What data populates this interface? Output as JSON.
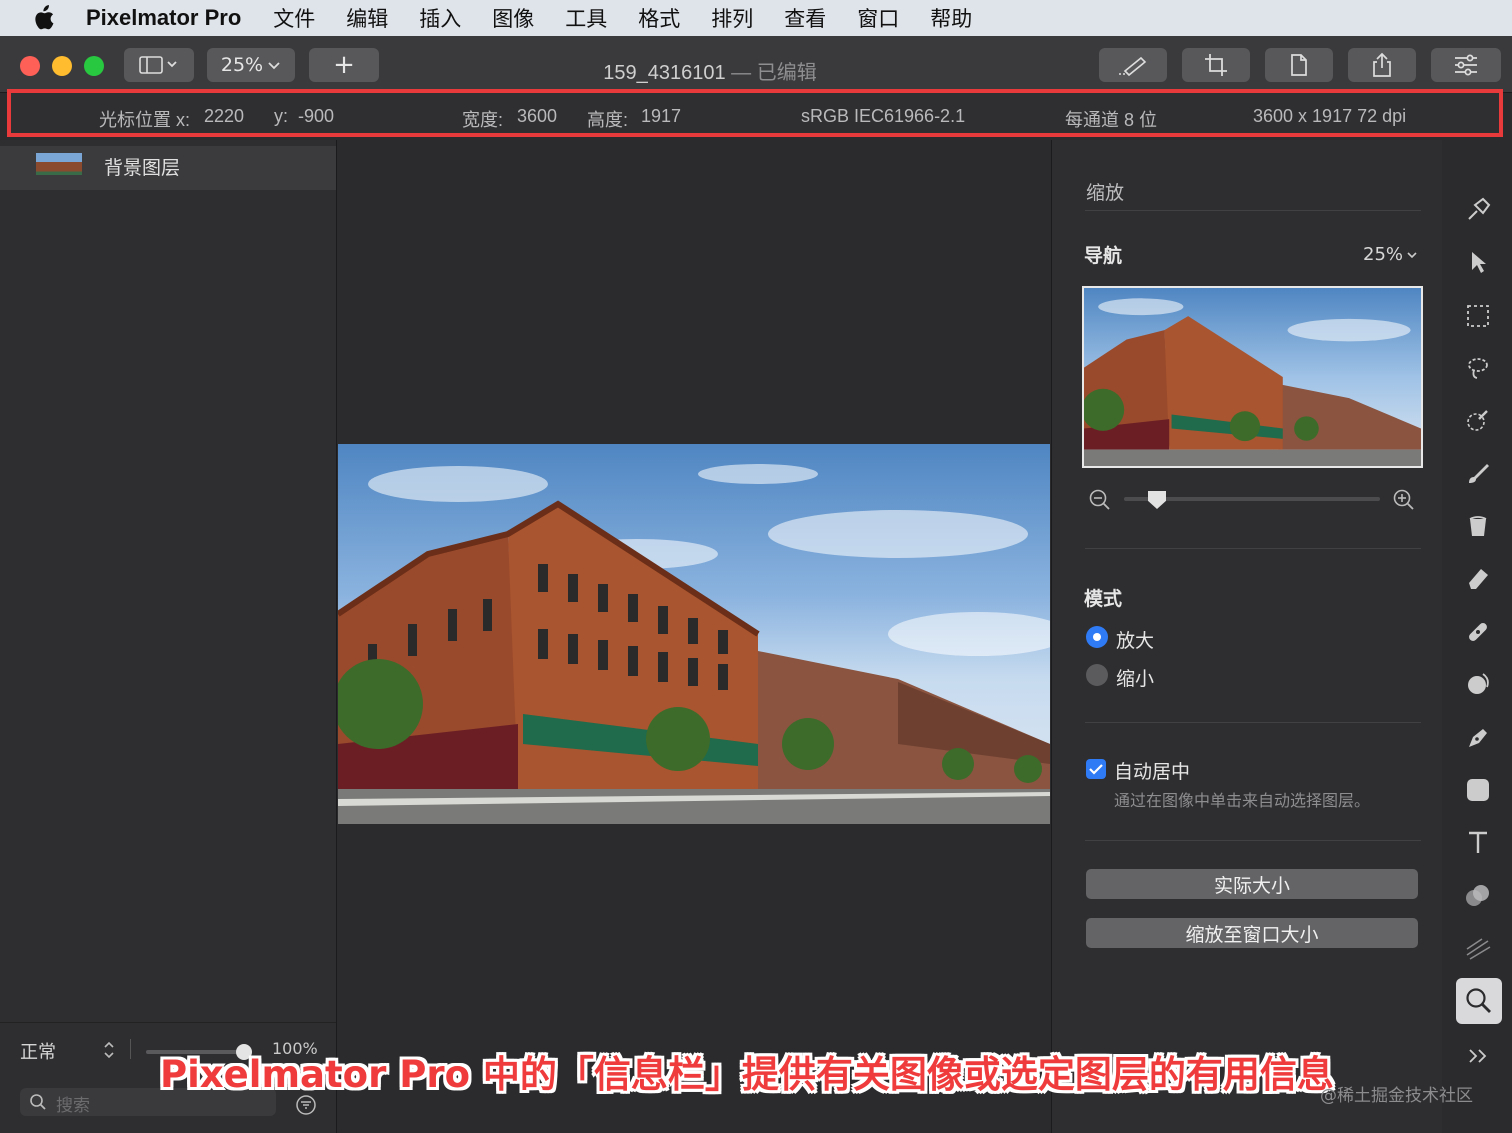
{
  "menubar": {
    "app_name": "Pixelmator Pro",
    "items": [
      "文件",
      "编辑",
      "插入",
      "图像",
      "工具",
      "格式",
      "排列",
      "查看",
      "窗口",
      "帮助"
    ]
  },
  "toolbar": {
    "zoom_label": "25%",
    "add_label": "+",
    "doc_name": "159_4316101",
    "doc_status": "— 已编辑"
  },
  "infobar": {
    "cursor_x_label": "光标位置 x:",
    "cursor_x_value": "2220",
    "cursor_y_label": "y:",
    "cursor_y_value": "-900",
    "width_label": "宽度:",
    "width_value": "3600",
    "height_label": "高度:",
    "height_value": "1917",
    "color_profile": "sRGB IEC61966-2.1",
    "bit_depth": "每通道 8 位",
    "dimensions": "3600 x 1917 72 dpi"
  },
  "layers": {
    "items": [
      {
        "name": "背景图层"
      }
    ],
    "blend_mode": "正常",
    "opacity": "100%",
    "opacity_fraction": 1.0,
    "search_placeholder": "搜索"
  },
  "inspector": {
    "title": "缩放",
    "nav_label": "导航",
    "nav_zoom": "25%",
    "zoom_slider_fraction": 0.13,
    "mode_label": "模式",
    "mode_options": [
      "放大",
      "缩小"
    ],
    "mode_selected": "放大",
    "auto_center_label": "自动居中",
    "auto_center_checked": true,
    "auto_center_desc": "通过在图像中单击来自动选择图层。",
    "actual_size_label": "实际大小",
    "fit_window_label": "缩放至窗口大小"
  },
  "overlay": {
    "caption": "Pixelmator Pro 中的「信息栏」提供有关图像或选定图层的有用信息",
    "watermark": "@稀土掘金技术社区"
  },
  "colors": {
    "highlight": "#e8393b",
    "accent": "#2f7bf6",
    "caption": "#ef3b3b"
  }
}
